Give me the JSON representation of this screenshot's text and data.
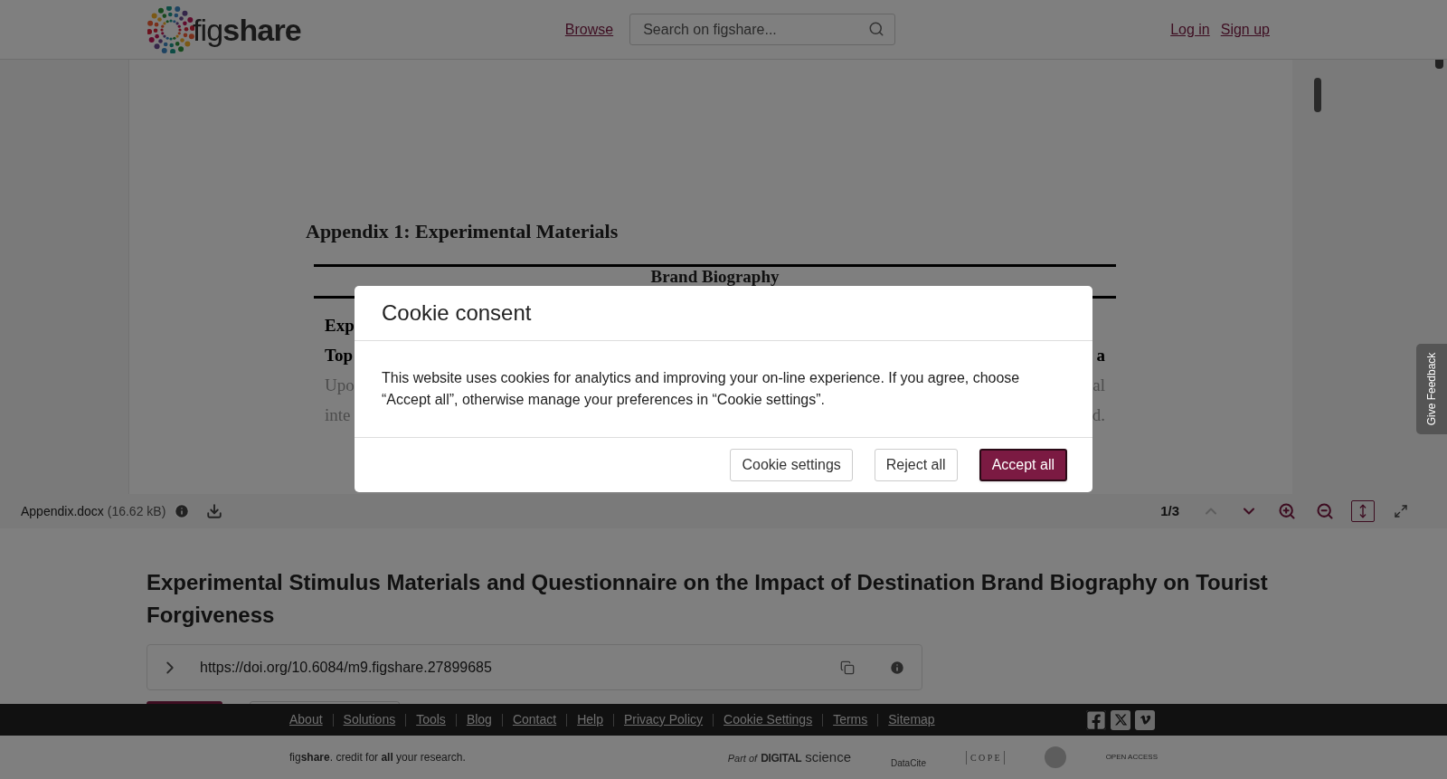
{
  "header": {
    "logo": {
      "prefix": "fig",
      "suffix": "share"
    },
    "nav": [
      "Browse"
    ],
    "search": {
      "placeholder": "Search on figshare..."
    },
    "auth": [
      "Log in",
      "Sign up"
    ]
  },
  "document": {
    "heading": "Appendix 1: Experimental Materials",
    "table_title": "Brand Biography",
    "rows": [
      {
        "left": "Exp",
        "right": "",
        "bold": true
      },
      {
        "left": "Top",
        "right": "a",
        "bold": true
      },
      {
        "left": "Upo",
        "right": "al",
        "bold": false
      },
      {
        "left": "inte",
        "right": "d.",
        "bold": false
      }
    ]
  },
  "viewer_bar": {
    "file_name": "Appendix.docx",
    "file_size": "(16.62 kB)",
    "page": "1/3",
    "controls": [
      {
        "kind": "prev",
        "disabled": true,
        "active": false
      },
      {
        "kind": "next",
        "disabled": false,
        "active": false
      },
      {
        "kind": "zoom_in",
        "disabled": false,
        "active": false
      },
      {
        "kind": "zoom_out",
        "disabled": false,
        "active": false
      },
      {
        "kind": "fit",
        "disabled": false,
        "active": true
      },
      {
        "kind": "fullscreen",
        "disabled": false,
        "active": false
      }
    ]
  },
  "item": {
    "title": "Experimental Stimulus Materials and Questionnaire on the Impact of Destination Brand Biography on Tourist Forgiveness",
    "doi": "https://doi.org/10.6084/m9.figshare.27899685"
  },
  "feedback_tab": "Give Feedback",
  "footer": {
    "links": [
      "About",
      "Solutions",
      "Tools",
      "Blog",
      "Contact",
      "Help",
      "Privacy Policy",
      "Cookie Settings",
      "Terms",
      "Sitemap"
    ],
    "social": [
      {
        "kind": "facebook"
      },
      {
        "kind": "x"
      },
      {
        "kind": "vimeo"
      }
    ],
    "tagline": "fig**share**. credit for **all** your research.",
    "partners": [
      {
        "kind": "digital_science",
        "text": "Part of",
        "text2": "DIGITAL",
        "text3": "science"
      },
      {
        "kind": "datacite",
        "text": "DataCite"
      },
      {
        "kind": "cope",
        "text": "C O P E"
      },
      {
        "kind": "seal"
      },
      {
        "kind": "open_access",
        "text": "OPEN ACCESS"
      }
    ]
  },
  "cookie_dialog": {
    "title": "Cookie consent",
    "body": "This website uses cookies for analytics and improving your on-line experience. If you agree, choose “Accept all”, otherwise manage your preferences in “Cookie settings”.",
    "buttons": [
      {
        "label": "Cookie settings",
        "primary": false
      },
      {
        "label": "Reject all",
        "primary": false
      },
      {
        "label": "Accept all",
        "primary": true
      }
    ]
  }
}
